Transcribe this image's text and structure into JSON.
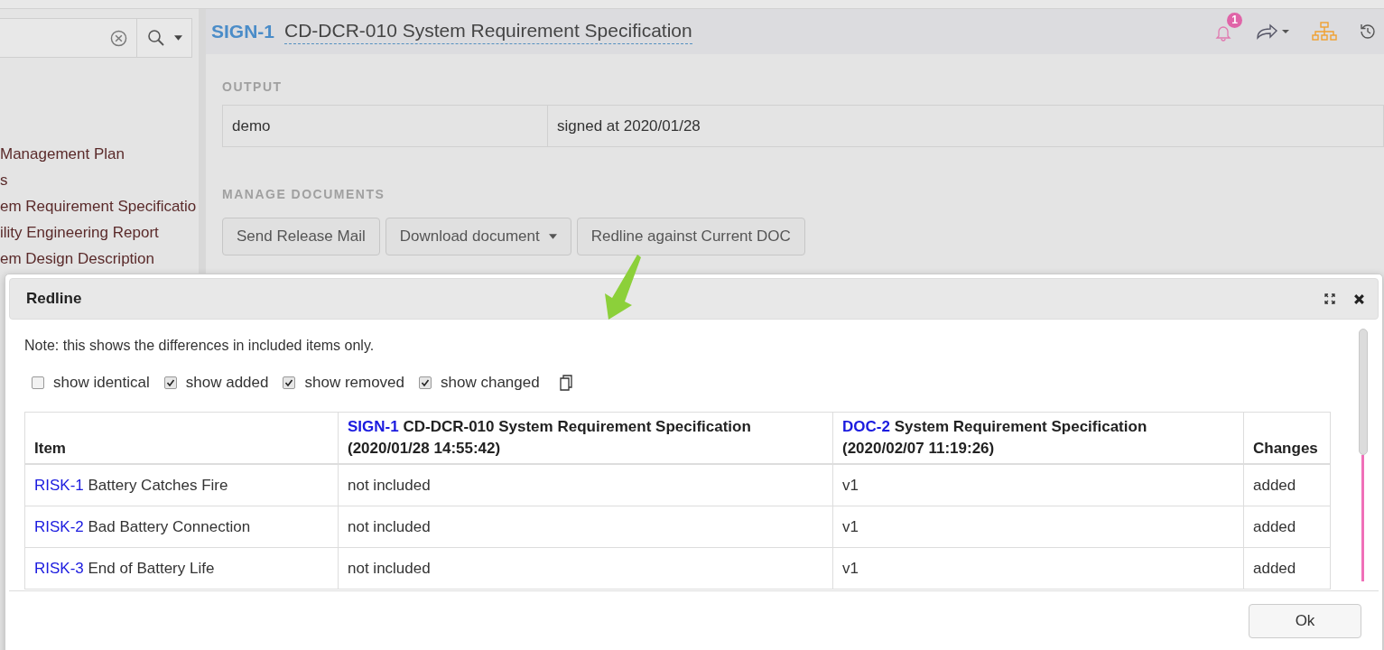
{
  "header": {
    "id": "SIGN-1",
    "title": "CD-DCR-010 System Requirement Specification",
    "notification_count": "1"
  },
  "sidebar": {
    "items": [
      "Management Plan",
      "s",
      "em Requirement Specificatio",
      "ility Engineering Report",
      "em Design Description"
    ]
  },
  "output": {
    "heading": "OUTPUT",
    "cells": [
      "demo",
      "signed at 2020/01/28"
    ]
  },
  "manage": {
    "heading": "MANAGE DOCUMENTS",
    "buttons": [
      {
        "label": "Send Release Mail",
        "kind": "plain"
      },
      {
        "label": "Download document",
        "kind": "dropdown"
      },
      {
        "label": "Redline against Current DOC",
        "kind": "plain"
      }
    ]
  },
  "dialog": {
    "title": "Redline",
    "note": "Note: this shows the differences in included items only.",
    "filters": [
      {
        "label": "show identical",
        "checked": false
      },
      {
        "label": "show added",
        "checked": true
      },
      {
        "label": "show removed",
        "checked": true
      },
      {
        "label": "show changed",
        "checked": true
      }
    ],
    "table": {
      "columns": [
        {
          "kind": "text",
          "title": "Item"
        },
        {
          "kind": "doc",
          "link": "SIGN-1",
          "title": "CD-DCR-010 System Requirement Specification",
          "date": "(2020/01/28 14:55:42)"
        },
        {
          "kind": "doc",
          "link": "DOC-2",
          "title": "System Requirement Specification",
          "date": "(2020/02/07 11:19:26)"
        },
        {
          "kind": "text",
          "title": "Changes"
        }
      ],
      "rows": [
        {
          "cells": [
            {
              "link": "RISK-1",
              "text": "Battery Catches Fire"
            },
            {
              "text": "not included"
            },
            {
              "text": "v1"
            },
            {
              "text": "added"
            }
          ]
        },
        {
          "cells": [
            {
              "link": "RISK-2",
              "text": "Bad Battery Connection"
            },
            {
              "text": "not included"
            },
            {
              "text": "v1"
            },
            {
              "text": "added"
            }
          ]
        },
        {
          "cells": [
            {
              "link": "RISK-3",
              "text": "End of Battery Life"
            },
            {
              "text": "not included"
            },
            {
              "text": "v1"
            },
            {
              "text": "added"
            }
          ]
        }
      ]
    },
    "ok": "Ok"
  }
}
